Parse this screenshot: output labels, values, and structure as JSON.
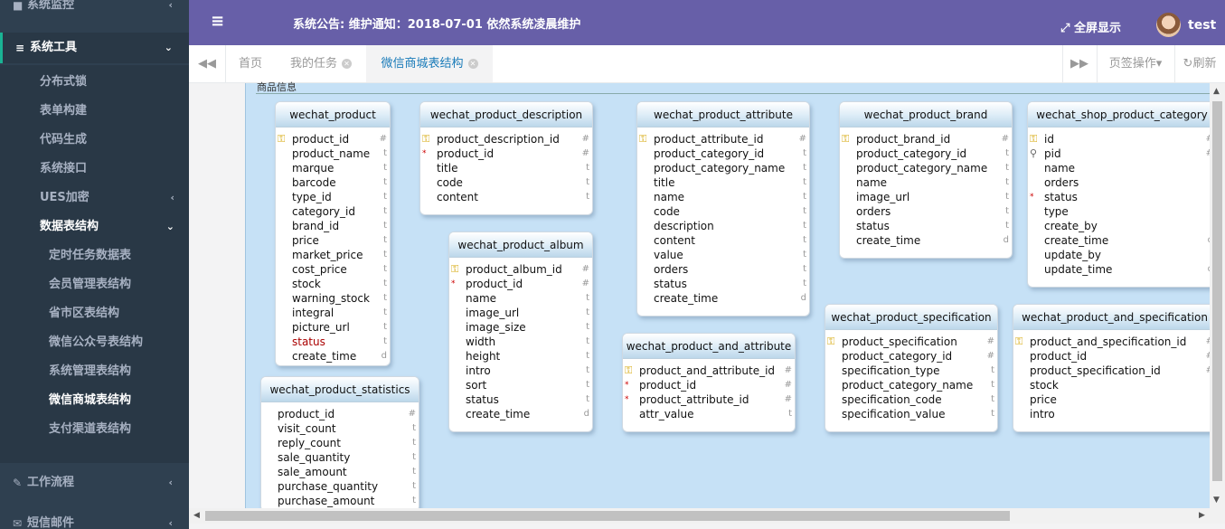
{
  "sidebar": {
    "monitor": "系统监控",
    "tools": "系统工具",
    "items": [
      "分布式锁",
      "表单构建",
      "代码生成",
      "系统接口",
      "UES加密",
      "数据表结构"
    ],
    "subitems": [
      "定时任务数据表",
      "会员管理表结构",
      "省市区表结构",
      "微信公众号表结构",
      "系统管理表结构",
      "微信商城表结构",
      "支付渠道表结构"
    ],
    "workflow": "工作流程",
    "sms": "短信邮件"
  },
  "header": {
    "notice": "系统公告: 维护通知：2018-07-01 依然系统凌晨维护",
    "fullscreen": "全屏显示",
    "user": "test"
  },
  "tabs": {
    "home": "首页",
    "items": [
      "我的任务",
      "微信商城表结构"
    ],
    "page_ops": "页签操作",
    "refresh": "刷新"
  },
  "canvas": {
    "title": "商品信息"
  },
  "tables": [
    {
      "name": "wechat_product",
      "fields": [
        {
          "n": "product_id",
          "t": "#",
          "m": "key"
        },
        {
          "n": "product_name",
          "t": "t"
        },
        {
          "n": "marque",
          "t": "t"
        },
        {
          "n": "barcode",
          "t": "t"
        },
        {
          "n": "type_id",
          "t": "t"
        },
        {
          "n": "category_id",
          "t": "t"
        },
        {
          "n": "brand_id",
          "t": "t"
        },
        {
          "n": "price",
          "t": "t"
        },
        {
          "n": "market_price",
          "t": "t"
        },
        {
          "n": "cost_price",
          "t": "t"
        },
        {
          "n": "stock",
          "t": "t"
        },
        {
          "n": "warning_stock",
          "t": "t"
        },
        {
          "n": "integral",
          "t": "t"
        },
        {
          "n": "picture_url",
          "t": "t"
        },
        {
          "n": "status",
          "t": "t",
          "m": "red"
        },
        {
          "n": "create_time",
          "t": "d"
        }
      ]
    },
    {
      "name": "wechat_product_description",
      "fields": [
        {
          "n": "product_description_id",
          "t": "#",
          "m": "key"
        },
        {
          "n": "product_id",
          "t": "#",
          "m": "star"
        },
        {
          "n": "title",
          "t": "t"
        },
        {
          "n": "code",
          "t": "t"
        },
        {
          "n": "content",
          "t": "t"
        }
      ]
    },
    {
      "name": "wechat_product_attribute",
      "fields": [
        {
          "n": "product_attribute_id",
          "t": "#",
          "m": "key"
        },
        {
          "n": "product_category_id",
          "t": "t"
        },
        {
          "n": "product_category_name",
          "t": "t"
        },
        {
          "n": "title",
          "t": "t"
        },
        {
          "n": "name",
          "t": "t"
        },
        {
          "n": "code",
          "t": "t"
        },
        {
          "n": "description",
          "t": "t"
        },
        {
          "n": "content",
          "t": "t"
        },
        {
          "n": "value",
          "t": "t"
        },
        {
          "n": "orders",
          "t": "t"
        },
        {
          "n": "status",
          "t": "t"
        },
        {
          "n": "create_time",
          "t": "d"
        }
      ]
    },
    {
      "name": "wechat_product_brand",
      "fields": [
        {
          "n": "product_brand_id",
          "t": "#",
          "m": "key"
        },
        {
          "n": "product_category_id",
          "t": "t"
        },
        {
          "n": "product_category_name",
          "t": "t"
        },
        {
          "n": "name",
          "t": "t"
        },
        {
          "n": "image_url",
          "t": "t"
        },
        {
          "n": "orders",
          "t": "t"
        },
        {
          "n": "status",
          "t": "t"
        },
        {
          "n": "create_time",
          "t": "d"
        }
      ]
    },
    {
      "name": "wechat_shop_product_category",
      "fields": [
        {
          "n": "id",
          "t": "#",
          "m": "key"
        },
        {
          "n": "pid",
          "t": "#",
          "m": "search"
        },
        {
          "n": "name",
          "t": "t"
        },
        {
          "n": "orders",
          "t": "t"
        },
        {
          "n": "status",
          "t": "t",
          "m": "star"
        },
        {
          "n": "type",
          "t": "t"
        },
        {
          "n": "create_by",
          "t": "t"
        },
        {
          "n": "create_time",
          "t": "d"
        },
        {
          "n": "update_by",
          "t": "t"
        },
        {
          "n": "update_time",
          "t": "d"
        }
      ]
    },
    {
      "name": "wechat_product_album",
      "fields": [
        {
          "n": "product_album_id",
          "t": "#",
          "m": "key"
        },
        {
          "n": "product_id",
          "t": "#",
          "m": "star"
        },
        {
          "n": "name",
          "t": "t"
        },
        {
          "n": "image_url",
          "t": "t"
        },
        {
          "n": "image_size",
          "t": "t"
        },
        {
          "n": "width",
          "t": "t"
        },
        {
          "n": "height",
          "t": "t"
        },
        {
          "n": "intro",
          "t": "t"
        },
        {
          "n": "sort",
          "t": "t"
        },
        {
          "n": "status",
          "t": "t"
        },
        {
          "n": "create_time",
          "t": "d"
        }
      ]
    },
    {
      "name": "wechat_product_and_attribute",
      "fields": [
        {
          "n": "product_and_attribute_id",
          "t": "#",
          "m": "key"
        },
        {
          "n": "product_id",
          "t": "#",
          "m": "star"
        },
        {
          "n": "product_attribute_id",
          "t": "#",
          "m": "star"
        },
        {
          "n": "attr_value",
          "t": "t"
        }
      ]
    },
    {
      "name": "wechat_product_specification",
      "fields": [
        {
          "n": "product_specification",
          "t": "#",
          "m": "key"
        },
        {
          "n": "product_category_id",
          "t": "#"
        },
        {
          "n": "specification_type",
          "t": "t"
        },
        {
          "n": "product_category_name",
          "t": "t"
        },
        {
          "n": "specification_code",
          "t": "t"
        },
        {
          "n": "specification_value",
          "t": "t"
        }
      ]
    },
    {
      "name": "wechat_product_and_specification",
      "fields": [
        {
          "n": "product_and_specification_id",
          "t": "#",
          "m": "key"
        },
        {
          "n": "product_id",
          "t": "#"
        },
        {
          "n": "product_specification_id",
          "t": "#"
        },
        {
          "n": "stock",
          "t": "t"
        },
        {
          "n": "price",
          "t": "t"
        },
        {
          "n": "intro",
          "t": "t"
        }
      ]
    },
    {
      "name": "wechat_product_statistics",
      "fields": [
        {
          "n": "product_id",
          "t": "#"
        },
        {
          "n": "visit_count",
          "t": "t"
        },
        {
          "n": "reply_count",
          "t": "t"
        },
        {
          "n": "sale_quantity",
          "t": "t"
        },
        {
          "n": "sale_amount",
          "t": "t"
        },
        {
          "n": "purchase_quantity",
          "t": "t"
        },
        {
          "n": "purchase_amount",
          "t": "t"
        }
      ]
    }
  ]
}
